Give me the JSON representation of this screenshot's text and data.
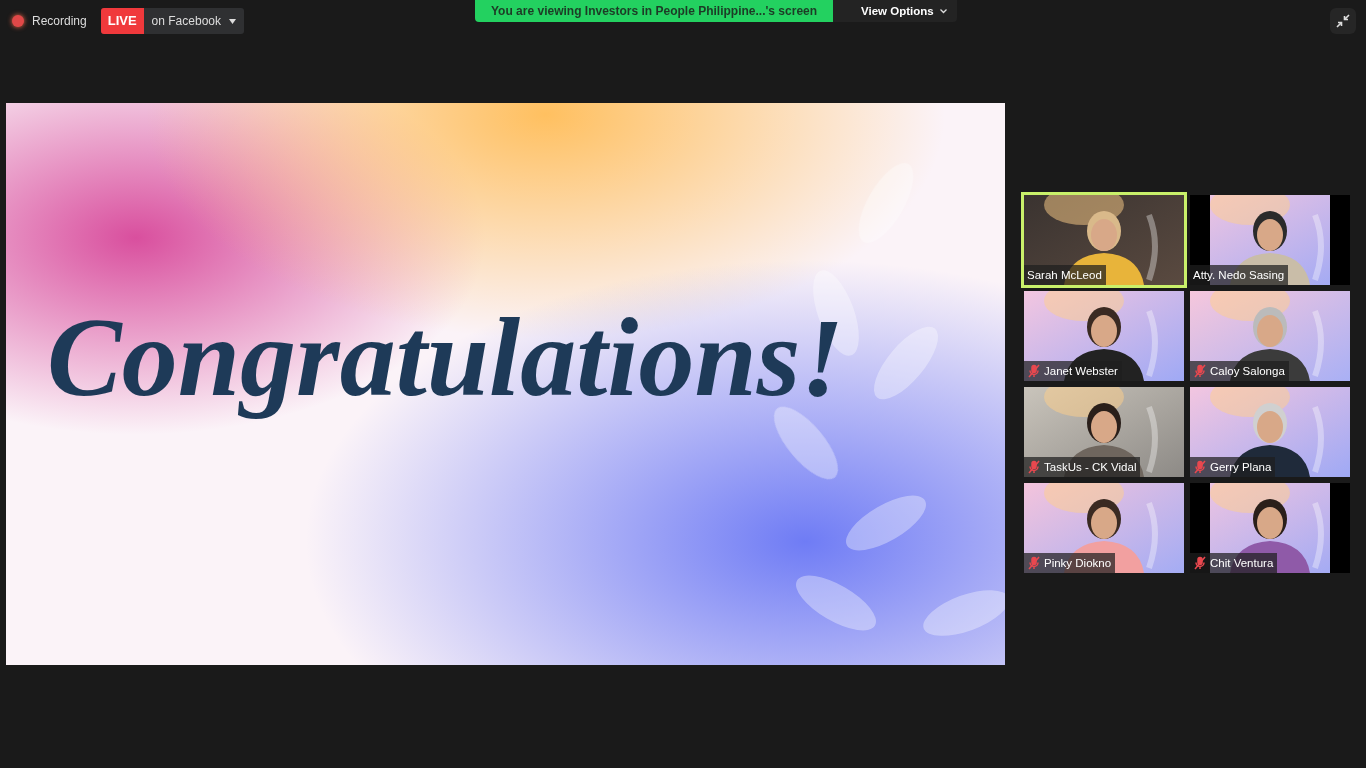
{
  "recording": {
    "label": "Recording",
    "on": true
  },
  "live": {
    "badge": "LIVE",
    "target": "on Facebook"
  },
  "share_banner": {
    "text": "You are viewing Investors in People Philippine...'s screen",
    "view_options": "View Options"
  },
  "shared_slide": {
    "headline": "Congratulations!"
  },
  "participants": [
    {
      "name": "Sarah McLeod",
      "muted": false,
      "speaking": true
    },
    {
      "name": "Atty. Nedo Sasing",
      "muted": false,
      "speaking": false
    },
    {
      "name": "Janet Webster",
      "muted": true,
      "speaking": false
    },
    {
      "name": "Caloy Salonga",
      "muted": true,
      "speaking": false
    },
    {
      "name": "TaskUs - CK Vidal",
      "muted": true,
      "speaking": false
    },
    {
      "name": "Gerry Plana",
      "muted": true,
      "speaking": false
    },
    {
      "name": "Pinky Diokno",
      "muted": true,
      "speaking": false
    },
    {
      "name": "Chit Ventura",
      "muted": true,
      "speaking": false
    }
  ]
}
